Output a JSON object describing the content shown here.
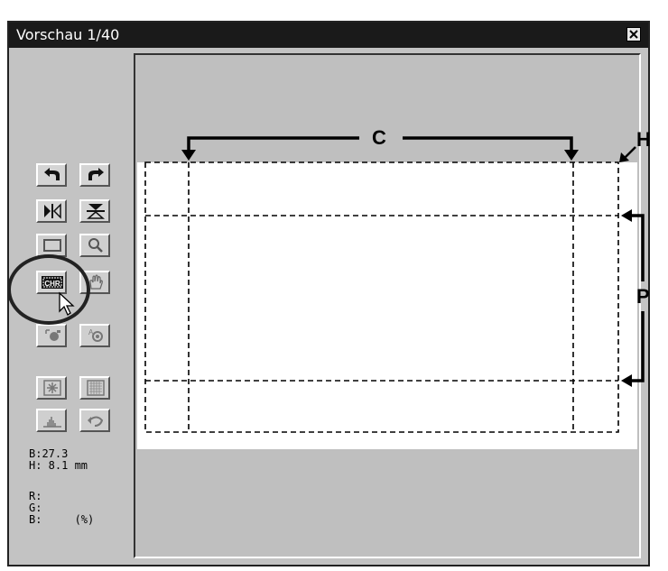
{
  "window": {
    "title": "Vorschau 1/40",
    "close_icon": "close-icon"
  },
  "toolbar": {
    "buttons": [
      {
        "name": "rotate-left",
        "icon": "rotate-left-icon"
      },
      {
        "name": "rotate-right",
        "icon": "rotate-right-icon"
      },
      {
        "name": "mirror-horizontal",
        "icon": "flip-horizontal-icon"
      },
      {
        "name": "mirror-vertical",
        "icon": "flip-vertical-icon"
      },
      {
        "name": "crop-frame",
        "icon": "crop-frame-icon"
      },
      {
        "name": "zoom",
        "icon": "magnifier-icon"
      },
      {
        "name": "chr",
        "icon": "chr-icon",
        "label": "CHR"
      },
      {
        "name": "hand",
        "icon": "hand-icon"
      },
      {
        "name": "auto-focus",
        "icon": "focus-target-icon"
      },
      {
        "name": "auto-focus-point",
        "icon": "focus-point-icon"
      },
      {
        "name": "dust-removal",
        "icon": "dust-icon"
      },
      {
        "name": "grain",
        "icon": "grain-icon"
      },
      {
        "name": "histogram",
        "icon": "histogram-icon"
      },
      {
        "name": "undo",
        "icon": "undo-icon"
      }
    ]
  },
  "info": {
    "width": "B:27.3",
    "height": "H: 8.1 mm",
    "r": "R:",
    "g": "G:",
    "b": "B:     (%)"
  },
  "callouts": {
    "c": "C",
    "h": "H",
    "p": "P"
  },
  "colors": {
    "window_bg": "#c3c3c3",
    "titlebar": "#1a1a1a",
    "preview_bg": "#bfbfbf",
    "image_bg": "#ffffff"
  }
}
